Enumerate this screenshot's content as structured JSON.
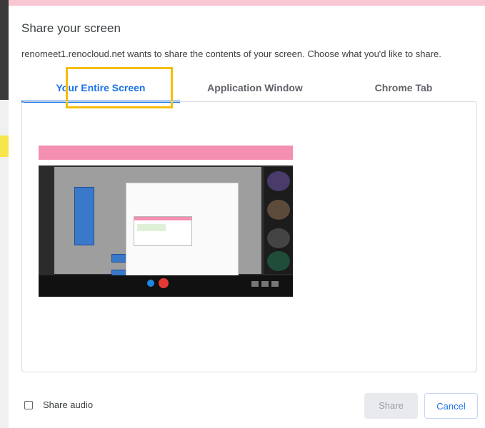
{
  "dialog": {
    "title": "Share your screen",
    "subtitle": "renomeet1.renocloud.net wants to share the contents of your screen. Choose what you'd like to share."
  },
  "tabs": [
    {
      "label": "Your Entire Screen",
      "active": true
    },
    {
      "label": "Application Window",
      "active": false
    },
    {
      "label": "Chrome Tab",
      "active": false
    }
  ],
  "share_audio": {
    "label": "Share audio",
    "checked": false
  },
  "buttons": {
    "share_label": "Share",
    "cancel_label": "Cancel"
  },
  "colors": {
    "accent": "#1a73e8",
    "highlight": "#f5bd0a"
  }
}
